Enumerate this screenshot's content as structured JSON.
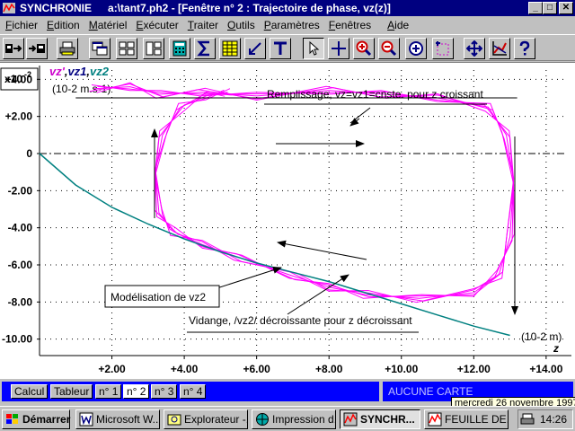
{
  "window": {
    "app_name": "SYNCHRONIE",
    "doc_title": "a:\\tant7.ph2 - [Fenêtre n° 2 :  Trajectoire de phase, vz(z)]",
    "buttons": {
      "minimize": "_",
      "maximize": "□",
      "close": "✕"
    }
  },
  "menu": [
    "Fichier",
    "Edition",
    "Matériel",
    "Exécuter",
    "Traiter",
    "Outils",
    "Paramètres",
    "Fenêtres",
    "Aide"
  ],
  "plot": {
    "scale_exponent_label": "x10",
    "scale_exponent_power": "-2",
    "y_title_parts": [
      {
        "text": "vz'",
        "color": "#cc00cc"
      },
      {
        "text": ",",
        "color": "#000000"
      },
      {
        "text": "vz1",
        "color": "#000080"
      },
      {
        "text": ",",
        "color": "#000000"
      },
      {
        "text": "vz2",
        "color": "#008080"
      }
    ],
    "y_units": "(10-2 m.s-1)",
    "x_units": "(10-2 m)",
    "x_axis_letter": "z",
    "y_ticks": [
      "+4.00",
      "+2.00",
      "0",
      "-2.00",
      "-4.00",
      "-6.00",
      "-8.00",
      "-10.00"
    ],
    "x_ticks": [
      "+2.00",
      "+4.00",
      "+6.00",
      "+8.00",
      "+10.00",
      "+12.00",
      "+14.00"
    ],
    "annotations": {
      "fill": "Remplissage, vz=vz1=cnste. pour z croissant",
      "model": "Modélisation de vz2",
      "drain": "Vidange, /vz2/ décroissante pour z décroissant"
    },
    "colors": {
      "measured": "#ff00ff",
      "model": "#008080",
      "vz1": "#000000"
    }
  },
  "chart_data": {
    "type": "line",
    "xlabel": "z",
    "x_unit": "(10-2 m)",
    "y_unit": "(10-2 m.s-1)",
    "xlim": [
      0,
      14.5
    ],
    "ylim": [
      -10.5,
      4.5
    ],
    "series": [
      {
        "name": "vz'",
        "x": [
          1.5,
          2.5,
          3.3,
          4.5,
          6.0,
          8.0,
          9.5,
          11.0,
          12.4,
          12.9,
          13.1,
          13.0,
          12.7,
          12.0,
          10.5,
          9.0,
          8.0,
          7.0,
          5.5,
          4.5,
          3.7,
          3.3,
          3.2,
          3.4,
          3.9,
          4.6,
          5.2
        ],
        "y": [
          3.5,
          3.6,
          3.2,
          3.3,
          3.1,
          3.4,
          3.2,
          3.0,
          2.5,
          1.0,
          -1.5,
          -4.5,
          -6.5,
          -7.5,
          -7.8,
          -7.6,
          -7.2,
          -6.6,
          -5.6,
          -4.9,
          -4.2,
          -3.2,
          -1.0,
          1.0,
          2.5,
          3.1,
          3.3
        ]
      },
      {
        "name": "vz1",
        "x": [
          1.0,
          13.2
        ],
        "y": [
          3.0,
          3.0
        ]
      },
      {
        "name": "vz2",
        "x": [
          0.0,
          1.0,
          2.0,
          3.0,
          4.0,
          5.0,
          6.0,
          7.0,
          8.0,
          9.0,
          10.0,
          11.0,
          12.0,
          13.0
        ],
        "y": [
          0.0,
          -1.7,
          -2.9,
          -3.8,
          -4.6,
          -5.3,
          -5.9,
          -6.4,
          -6.9,
          -7.5,
          -8.1,
          -8.7,
          -9.3,
          -9.8
        ]
      }
    ]
  },
  "tabs": [
    "Calcul",
    "Tableur",
    "n° 1",
    "n° 2",
    "n° 3",
    "n° 4"
  ],
  "active_tab": "n° 2",
  "status": {
    "card": "AUCUNE CARTE",
    "date_tooltip": "mercredi 26 novembre 1997"
  },
  "taskbar": {
    "start": "Démarrer",
    "tasks": [
      "Microsoft W...",
      "Explorateur -...",
      "Impression d...",
      "SYNCHR...",
      "FEUILLE DE..."
    ],
    "clock": "14:26"
  }
}
